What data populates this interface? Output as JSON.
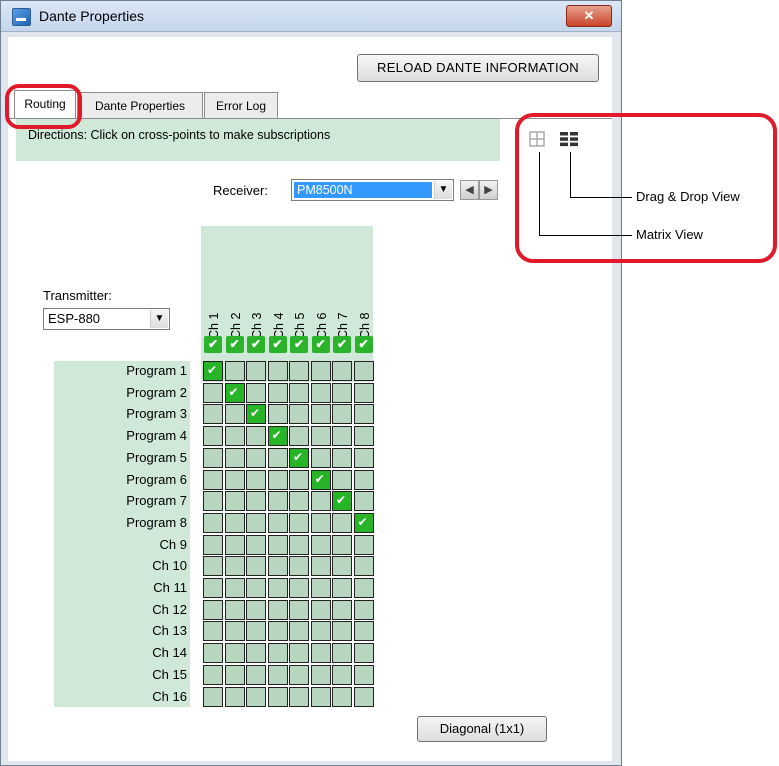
{
  "window": {
    "title": "Dante Properties",
    "close_glyph": "✕",
    "accent_color": "#cfe8d8"
  },
  "toolbar": {
    "reload_label": "RELOAD DANTE INFORMATION"
  },
  "tabs": [
    {
      "label": "Routing",
      "active": true
    },
    {
      "label": "Dante Properties",
      "active": false
    },
    {
      "label": "Error Log",
      "active": false
    }
  ],
  "directions": "Directions: Click on cross-points to make subscriptions",
  "receiver": {
    "label": "Receiver:",
    "value": "PM8500N"
  },
  "transmitter": {
    "label": "Transmitter:",
    "value": "ESP-880"
  },
  "matrix": {
    "columns": [
      "Ch 1",
      "Ch 2",
      "Ch 3",
      "Ch 4",
      "Ch 5",
      "Ch 6",
      "Ch 7",
      "Ch 8"
    ],
    "rows": [
      "Program 1",
      "Program 2",
      "Program 3",
      "Program 4",
      "Program 5",
      "Program 6",
      "Program 7",
      "Program 8",
      "Ch 9",
      "Ch 10",
      "Ch 11",
      "Ch 12",
      "Ch 13",
      "Ch 14",
      "Ch 15",
      "Ch 16"
    ],
    "subscriptions": [
      [
        0,
        0
      ],
      [
        1,
        1
      ],
      [
        2,
        2
      ],
      [
        3,
        3
      ],
      [
        4,
        4
      ],
      [
        5,
        5
      ],
      [
        6,
        6
      ],
      [
        7,
        7
      ]
    ]
  },
  "diagonal_label": "Diagonal (1x1)",
  "callouts": {
    "drag_drop_view": "Drag & Drop View",
    "matrix_view": "Matrix View",
    "highlight_color": "#e01a2a"
  },
  "icons": {
    "matrix_view": "grid-icon",
    "drag_drop_view": "list-grid-icon",
    "combo_arrow": "▼",
    "prev": "◀",
    "next": "▶"
  }
}
